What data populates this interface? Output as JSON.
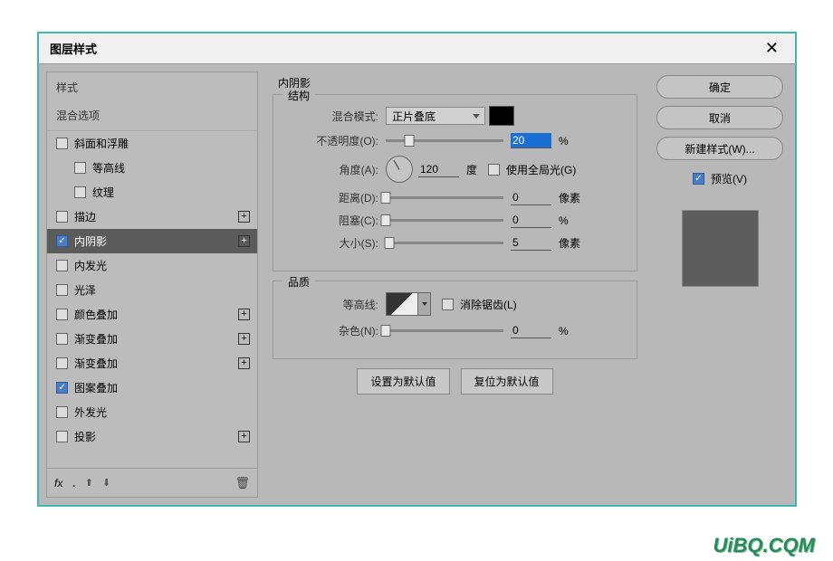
{
  "title": "图层样式",
  "sidebar": {
    "styles_header": "样式",
    "blend_header": "混合选项",
    "items": [
      {
        "label": "斜面和浮雕",
        "checked": false,
        "plus": false,
        "indent": false
      },
      {
        "label": "等高线",
        "checked": false,
        "plus": false,
        "indent": true
      },
      {
        "label": "纹理",
        "checked": false,
        "plus": false,
        "indent": true
      },
      {
        "label": "描边",
        "checked": false,
        "plus": true,
        "indent": false
      },
      {
        "label": "内阴影",
        "checked": true,
        "plus": true,
        "indent": false,
        "selected": true
      },
      {
        "label": "内发光",
        "checked": false,
        "plus": false,
        "indent": false
      },
      {
        "label": "光泽",
        "checked": false,
        "plus": false,
        "indent": false
      },
      {
        "label": "颜色叠加",
        "checked": false,
        "plus": true,
        "indent": false
      },
      {
        "label": "渐变叠加",
        "checked": false,
        "plus": true,
        "indent": false
      },
      {
        "label": "渐变叠加",
        "checked": false,
        "plus": true,
        "indent": false
      },
      {
        "label": "图案叠加",
        "checked": true,
        "plus": false,
        "indent": false
      },
      {
        "label": "外发光",
        "checked": false,
        "plus": false,
        "indent": false
      },
      {
        "label": "投影",
        "checked": false,
        "plus": true,
        "indent": false
      }
    ],
    "fx": "fx"
  },
  "main": {
    "title": "内阴影",
    "fieldset1": "结构",
    "blend_mode_label": "混合模式:",
    "blend_mode_value": "正片叠底",
    "opacity_label": "不透明度(O):",
    "opacity_value": "20",
    "opacity_unit": "%",
    "angle_label": "角度(A):",
    "angle_value": "120",
    "angle_unit": "度",
    "global_light": "使用全局光(G)",
    "distance_label": "距离(D):",
    "distance_value": "0",
    "distance_unit": "像素",
    "choke_label": "阻塞(C):",
    "choke_value": "0",
    "choke_unit": "%",
    "size_label": "大小(S):",
    "size_value": "5",
    "size_unit": "像素",
    "fieldset2": "品质",
    "contour_label": "等高线:",
    "antialias": "消除锯齿(L)",
    "noise_label": "杂色(N):",
    "noise_value": "0",
    "noise_unit": "%",
    "btn_default": "设置为默认值",
    "btn_reset": "复位为默认值"
  },
  "right": {
    "ok": "确定",
    "cancel": "取消",
    "new_style": "新建样式(W)...",
    "preview": "预览(V)"
  },
  "watermark": "UiBQ.CQM"
}
